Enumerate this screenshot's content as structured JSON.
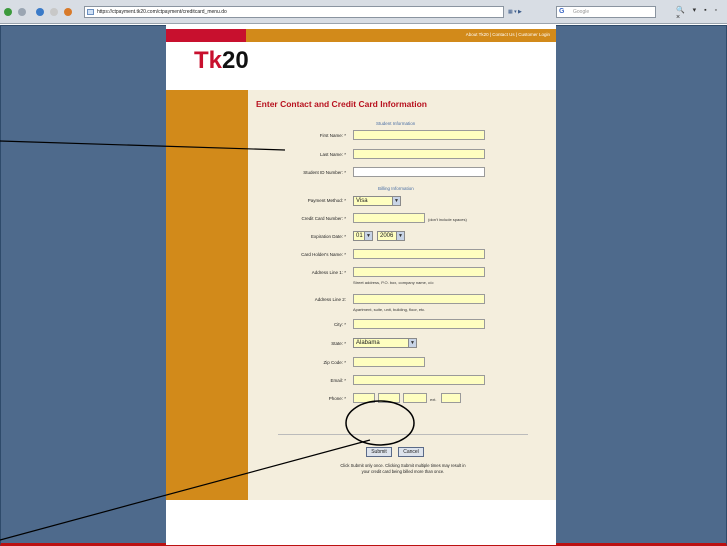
{
  "browser": {
    "url": "https://ctpayment.tk20.com/ctpayment/creditcard_menu.do",
    "search_placeholder": "Google"
  },
  "site": {
    "logo_prefix": "Tk",
    "logo_suffix": "20",
    "top_nav": "About Tk20  |  Contact Us  |  Customer Login"
  },
  "form": {
    "heading": "Enter Contact and Credit Card Information",
    "student_section": "Student Information",
    "billing_section": "Billing Information",
    "first_name_label": "First Name: *",
    "last_name_label": "Last Name: *",
    "student_id_label": "Student ID Number: *",
    "payment_method_label": "Payment Method: *",
    "payment_method_value": "Visa",
    "cc_number_label": "Credit Card Number: *",
    "cc_hint": "(don't include spaces)",
    "expiration_label": "Expiration Date: *",
    "exp_month": "01",
    "exp_year": "2006",
    "card_holder_label": "Card Holder's Name: *",
    "address1_label": "Address Line 1: *",
    "address1_hint": "Street address, P.O. box, company name, c/o",
    "address2_label": "Address Line 2:",
    "address2_hint": "Apartment, suite, unit, building, floor, etc.",
    "city_label": "City: *",
    "state_label": "State: *",
    "state_value": "Alabama",
    "zip_label": "Zip Code: *",
    "email_label": "Email: *",
    "phone_label": "Phone: *",
    "ext_label": "ext.",
    "submit_label": "Submit",
    "cancel_label": "Cancel",
    "note_line1": "Click Submit only once. Clicking Submit multiple times may result in",
    "note_line2": "your credit card being billed more than once."
  },
  "colors": {
    "brand_red": "#c8102e",
    "brand_orange": "#d28a1a",
    "input_yellow": "#fefec0",
    "page_bg": "#4e6a8c"
  }
}
